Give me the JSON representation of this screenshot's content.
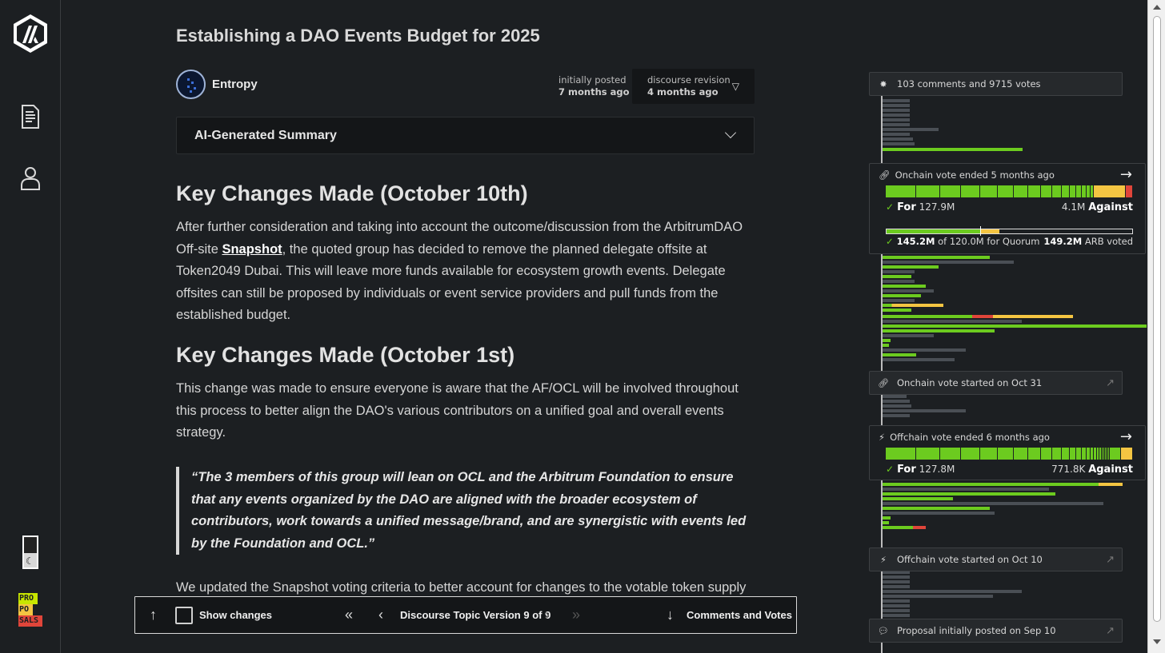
{
  "colors": {
    "for": "#6ccb1f",
    "against": "#e0453a",
    "abstain": "#f4c542",
    "muted": "#4a4f55"
  },
  "sidebar": {
    "logo": "arbitrum-logo",
    "items": [
      {
        "name": "proposals",
        "icon": "document-icon"
      },
      {
        "name": "delegates",
        "icon": "user-icon"
      }
    ],
    "theme_toggle": "moon-icon",
    "brand_badge": [
      "PRO",
      "PO",
      "SALS"
    ]
  },
  "post": {
    "title": "Establishing a DAO Events Budget for 2025",
    "author": "Entropy",
    "initially_posted_label": "initially posted",
    "initially_posted_value": "7 months ago",
    "revision_label": "discourse revision",
    "revision_value": "4 months ago",
    "summary_label": "AI-Generated Summary",
    "h1": "Key Changes Made (October 10th)",
    "p1_before": "After further consideration and taking into account the outcome/discussion from the ArbitrumDAO Off-site ",
    "p1_link": "Snapshot",
    "p1_after": ", the quoted group has decided to remove the planned delegate offsite at Token2049 Dubai. This will leave more funds available for ecosystem growth events. Delegate offsites can still be proposed by individuals or event service providers and pull funds from the established budget.",
    "h2": "Key Changes Made (October 1st)",
    "p2": "This change was made to ensure everyone is aware that the AF/OCL will be involved throughout this process to better align the DAO's various contributors on a unified goal and overall events strategy.",
    "quote": "“The 3 members of this group will lean on OCL and the Arbitrum Foundation to ensure that any events organized by the DAO are aligned with the broader ecosystem of contributors, work towards a unified message/brand, and are synergistic with events led by the Foundation and OCL.”",
    "p3": "We updated the Snapshot voting criteria to better account for changes to the votable token supply and the proposal to support this change."
  },
  "toolbar": {
    "show_changes": "Show changes",
    "version": "Discourse Topic Version 9 of 9",
    "comments_votes": "Comments and Votes"
  },
  "timeline": {
    "summary": "103 comments and 9715 votes",
    "onchain_card": {
      "title": "Onchain vote ended 5 months ago",
      "for_label": "For",
      "for_value": "127.9M",
      "against_value": "4.1M",
      "against_label": "Against",
      "quorum_current": "145.2M",
      "quorum_text": "of 120.0M for Quorum",
      "arb_voted": "149.2M",
      "arb_voted_label": "ARB voted",
      "for_share": 0.84,
      "abstain_share": 0.13,
      "against_share": 0.03
    },
    "onchain_started": "Onchain vote started on Oct 31",
    "offchain_card": {
      "title": "Offchain vote ended 6 months ago",
      "for_label": "For",
      "for_value": "127.8M",
      "against_value": "771.8K",
      "against_label": "Against",
      "for_share": 0.95,
      "abstain_share": 0.05
    },
    "offchain_started": "Offchain vote started on Oct 10",
    "initially_posted": "Proposal initially posted on Sep 10"
  }
}
